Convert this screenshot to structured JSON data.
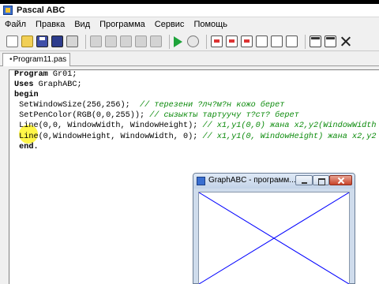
{
  "window": {
    "title": "Pascal ABC",
    "icon": "pascal-abc-icon"
  },
  "menu": {
    "items": [
      "Файл",
      "Правка",
      "Вид",
      "Программа",
      "Сервис",
      "Помощь"
    ]
  },
  "toolbar": {
    "buttons": [
      "new-file-icon",
      "open-folder-icon",
      "save-icon",
      "save-all-icon",
      "print-icon",
      "cut-icon",
      "copy-icon",
      "paste-icon",
      "undo-icon",
      "redo-icon",
      "run-icon",
      "debug-icon",
      "step-into-icon",
      "step-over-icon",
      "step-out-icon",
      "watch-icon",
      "stop-icon",
      "compile-icon",
      "layout-icon",
      "window-icon",
      "close-icon"
    ]
  },
  "tabs": [
    {
      "mark": "•",
      "label": "Program11.pas"
    }
  ],
  "editor": {
    "lines": [
      [
        {
          "t": "Program",
          "c": "kw"
        },
        {
          "t": " Gr01;",
          "c": "fn"
        }
      ],
      [
        {
          "t": "Uses",
          "c": "kw"
        },
        {
          "t": " GraphABC;",
          "c": "fn"
        }
      ],
      [
        {
          "t": "begin",
          "c": "kw"
        }
      ],
      [
        {
          "t": " SetWindowSize(256,256);  ",
          "c": "fn"
        },
        {
          "t": "// терезени ?лч?м?н кожо берет",
          "c": "cm"
        }
      ],
      [
        {
          "t": " SetPenColor(RGB(0,0,255)); ",
          "c": "fn"
        },
        {
          "t": "// сызыкты тартуучу т?ст? берет",
          "c": "cm"
        }
      ],
      [
        {
          "t": " Line(0,0, WindowWidth, WindowHeight); ",
          "c": "fn"
        },
        {
          "t": "// x1,y1(0,0) жана x2,y2(WindowWidth",
          "c": "cm"
        }
      ],
      [
        {
          "t": " Line(0,WindowHeight, WindowWidth, 0); ",
          "c": "fn"
        },
        {
          "t": "// x1,y1(0, WindowHeight) жана x2,y2",
          "c": "cm"
        }
      ],
      [
        {
          "t": " end.",
          "c": "kw"
        }
      ]
    ]
  },
  "graph_window": {
    "title": "GraphABC - программ...",
    "line_color": "#0000ff"
  }
}
